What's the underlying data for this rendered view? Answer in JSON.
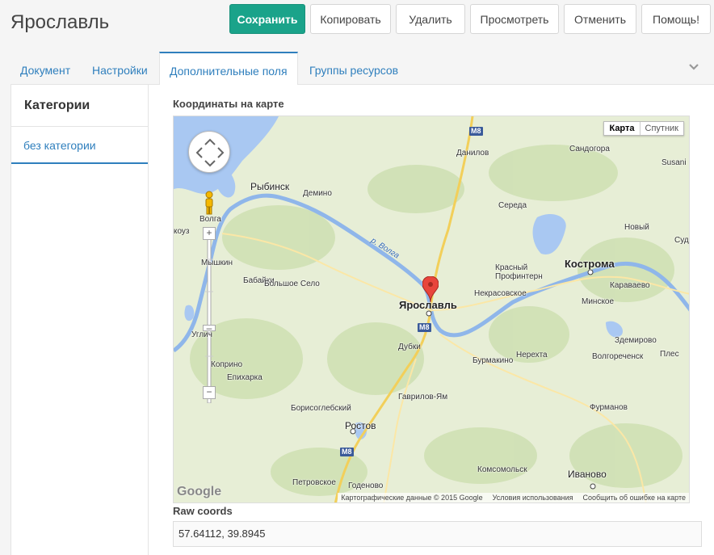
{
  "page": {
    "title": "Ярославль"
  },
  "toolbar": {
    "save": "Сохранить",
    "copy": "Копировать",
    "delete": "Удалить",
    "view": "Просмотреть",
    "cancel": "Отменить",
    "help": "Помощь!"
  },
  "tabs": [
    {
      "label": "Документ",
      "active": false
    },
    {
      "label": "Настройки",
      "active": false
    },
    {
      "label": "Дополнительные поля",
      "active": true
    },
    {
      "label": "Группы ресурсов",
      "active": false
    }
  ],
  "categories": {
    "header": "Категории",
    "items": [
      "без категории"
    ]
  },
  "map_field": {
    "label": "Координаты на карте",
    "map_type": {
      "map": "Карта",
      "satellite": "Спутник"
    },
    "pegman_label": "Волга",
    "places": {
      "yaroslavl": "Ярославль",
      "kostroma": "Кострома",
      "rybinsk": "Рыбинск",
      "ivanovo": "Иваново",
      "rostov": "Ростов",
      "danilov": "Данилов",
      "uglich": "Углич",
      "demino": "Демино",
      "sandogora": "Сандогора",
      "susanino": "Susani",
      "sereda": "Середа",
      "nerehta": "Нерехта",
      "krasny_profintern": "Красный Профинтерн",
      "nekrasovskoe": "Некрасовское",
      "karavaevo": "Караваево",
      "minskoe": "Минское",
      "zdemirovo": "Здемирово",
      "volgorechensk": "Волгореченск",
      "ples": "Плес",
      "burmakino": "Бурмакино",
      "dubki": "Дубки",
      "gavrilov_yam": "Гаврилов-Ям",
      "borisoglebsky": "Борисоглебский",
      "furmanov": "Фурманов",
      "komsomolsk": "Комсомольск",
      "petrovskoe": "Петровское",
      "godenovo": "Годеново",
      "mishkin": "Мышкин",
      "babayki": "Бабайки",
      "bolshoe_selo": "Большое Село",
      "epiharka": "Епихарка",
      "koprino": "Коприно",
      "novy": "Новый",
      "sud": "Суд",
      "kouz": "коуз"
    },
    "river": "р. Волга",
    "road_m8": "M8",
    "attribution": {
      "data": "Картографические данные © 2015 Google",
      "terms": "Условия использования",
      "report": "Сообщить об ошибке на карте"
    },
    "logo": "Google"
  },
  "raw_coords": {
    "label": "Raw coords",
    "value": "57.64112, 39.8945"
  }
}
